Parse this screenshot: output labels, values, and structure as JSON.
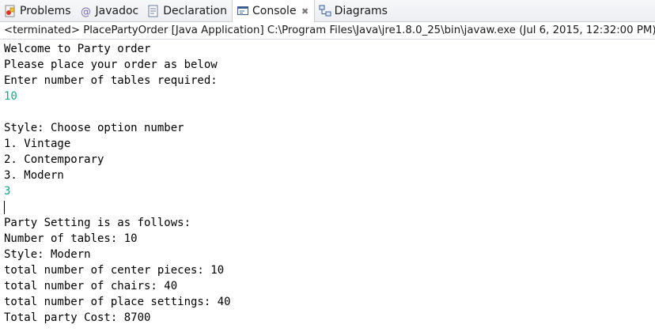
{
  "tabs": [
    {
      "label": "Problems",
      "icon": "problems-icon"
    },
    {
      "label": "Javadoc",
      "icon": "javadoc-icon"
    },
    {
      "label": "Declaration",
      "icon": "declaration-icon"
    },
    {
      "label": "Console",
      "icon": "console-icon",
      "active": true,
      "close": "✖"
    },
    {
      "label": "Diagrams",
      "icon": "diagrams-icon"
    }
  ],
  "status": "<terminated> PlacePartyOrder [Java Application] C:\\Program Files\\Java\\jre1.8.0_25\\bin\\javaw.exe (Jul 6, 2015, 12:32:00 PM)",
  "console": {
    "lines": [
      "Welcome to Party order",
      "Please place your order as below",
      "Enter number of tables required:",
      "10",
      "",
      "Style: Choose option number",
      "1. Vintage",
      "2. Contemporary",
      "3. Modern",
      "3",
      "",
      "Party Setting is as follows:",
      "Number of tables: 10",
      "Style: Modern",
      "total number of center pieces: 10",
      "total number of chairs: 40",
      "total number of place settings: 40",
      "Total party Cost: 8700"
    ]
  },
  "colors": {
    "input_text": "#17a589",
    "output_text": "#000000",
    "tab_active_bg": "#ffffff"
  }
}
